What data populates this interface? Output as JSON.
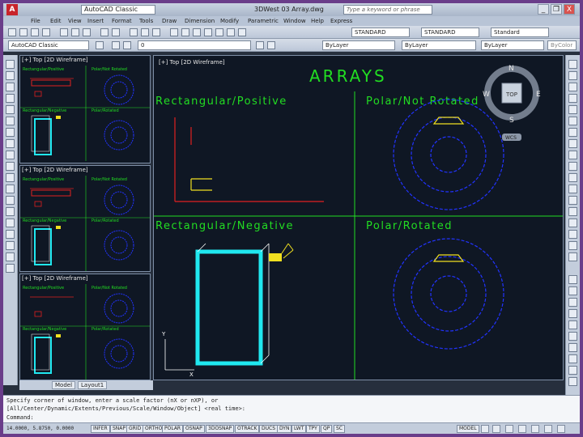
{
  "titlebar": {
    "app_logo": "A",
    "workspace": "AutoCAD Classic",
    "title": "3DWest 03 Array.dwg",
    "search_placeholder": "Type a keyword or phrase",
    "minimize": "_",
    "restore": "❐",
    "close": "X"
  },
  "menubar": {
    "items": [
      "File",
      "Edit",
      "View",
      "Insert",
      "Format",
      "Tools",
      "Draw",
      "Dimension",
      "Modify",
      "Parametric",
      "Window",
      "Help",
      "Express"
    ]
  },
  "toolbar1": {
    "text_style": "STANDARD",
    "dim_style": "STANDARD",
    "table_style": "Standard"
  },
  "toolbar2": {
    "workspace": "AutoCAD Classic",
    "layer": "0",
    "color": "ByLayer",
    "linetype": "ByLayer",
    "lineweight": "ByLayer",
    "plotstyle": "ByColor"
  },
  "viewports": {
    "small_label": "[+] Top [2D Wireframe]",
    "main_label": "[+] Top [2D Wireframe]",
    "thumb_label_rect_pos": "Rectangular/Positive",
    "thumb_label_polar_not": "Polar/Not Rotated",
    "thumb_label_rect_neg": "Rectangular/Negative",
    "thumb_label_polar_rot": "Polar/Rotated"
  },
  "drawing": {
    "title": "ARRAYS",
    "rect_positive": "Rectangular/Positive",
    "polar_not_rotated": "Polar/Not Rotated",
    "rect_negative": "Rectangular/Negative",
    "polar_rotated": "Polar/Rotated"
  },
  "viewcube": {
    "n": "N",
    "s": "S",
    "e": "E",
    "w": "W",
    "top": "TOP",
    "wcs": "WCS"
  },
  "tabs": {
    "model": "Model",
    "layout": "Layout1"
  },
  "command": {
    "line1": "Specify corner of window, enter a scale factor (nX or nXP), or",
    "line2": "[All/Center/Dynamic/Extents/Previous/Scale/Window/Object] <real time>:",
    "prompt": "Command:"
  },
  "status": {
    "coords": "14.0000, 5.8750, 0.0000",
    "buttons": [
      "INFER",
      "SNAP",
      "GRID",
      "ORTHO",
      "POLAR",
      "OSNAP",
      "3DOSNAP",
      "OTRACK",
      "DUCS",
      "DYN",
      "LWT",
      "TPY",
      "QP",
      "SC"
    ],
    "model": "MODEL"
  },
  "colors": {
    "red": "#e02020",
    "yellow": "#f0e020",
    "cyan": "#20e8f0",
    "blue": "#2233ff",
    "green": "#22dd22"
  }
}
